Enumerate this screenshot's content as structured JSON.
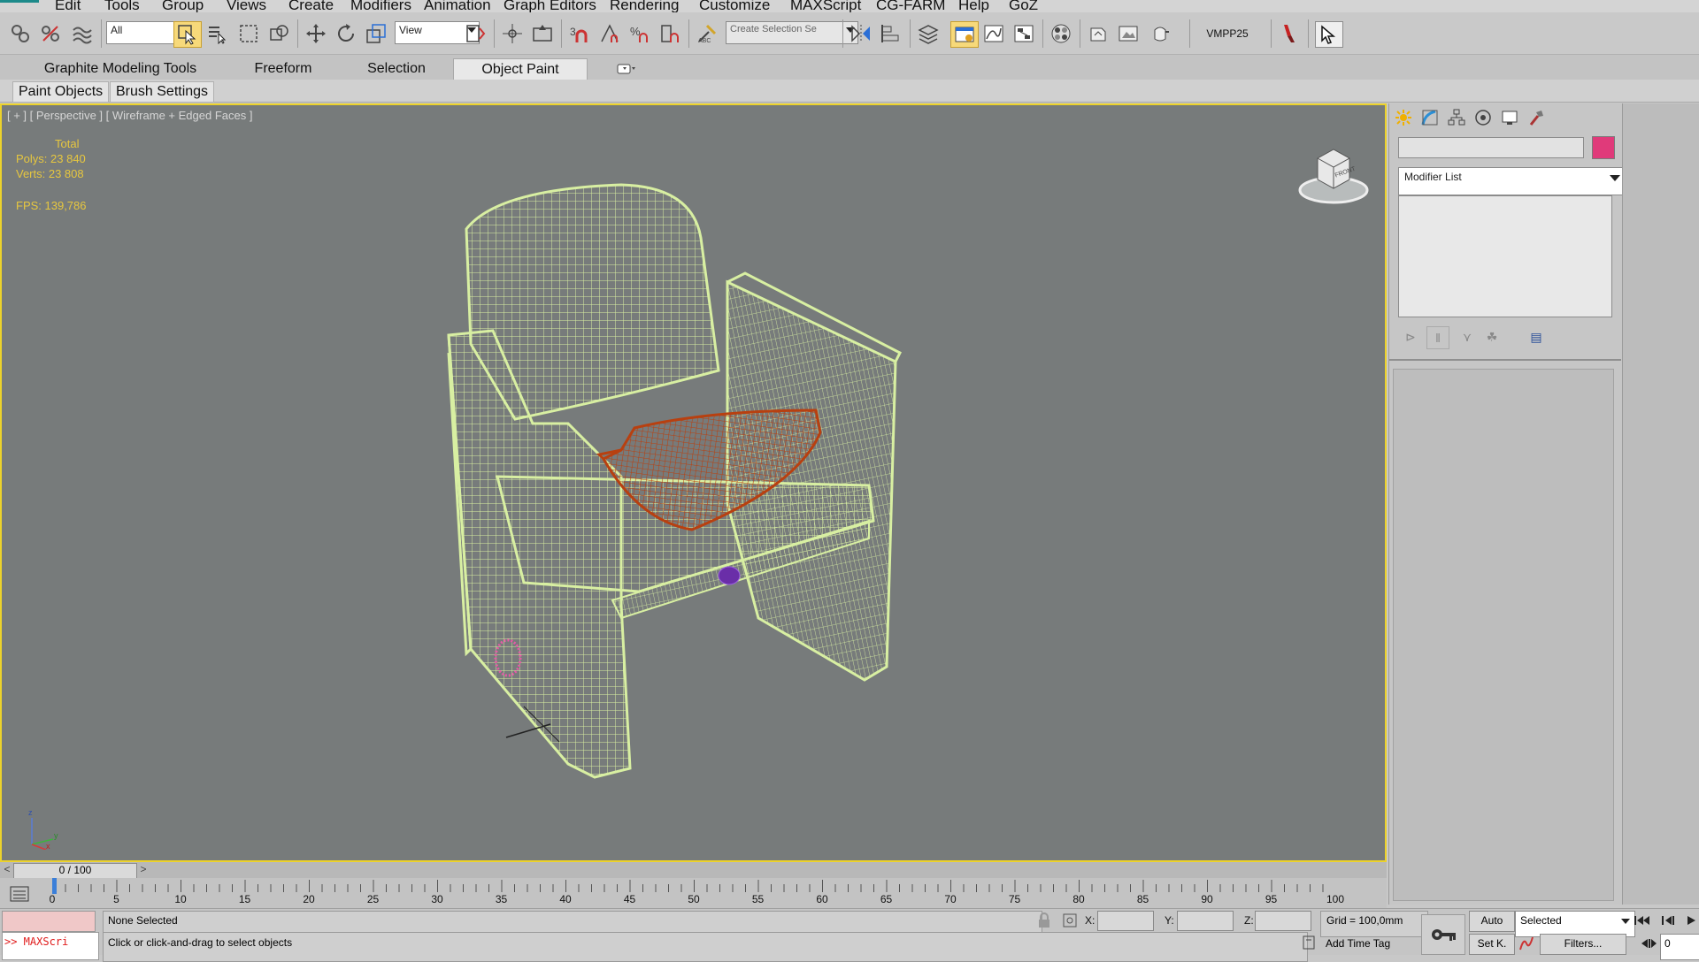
{
  "menubar": {
    "items": [
      "Edit",
      "Tools",
      "Group",
      "Views",
      "Create",
      "Modifiers",
      "Animation",
      "Graph Editors",
      "Rendering",
      "Customize",
      "MAXScript",
      "CG-FARM",
      "Help",
      "GoZ"
    ]
  },
  "toolbar": {
    "selection_filter": "All",
    "reference_coord": "View",
    "named_selection_placeholder": "Create Selection Se",
    "vmpp_label": "VMPP25"
  },
  "ribbon": {
    "tabs": [
      "Graphite Modeling Tools",
      "Freeform",
      "Selection",
      "Object Paint"
    ],
    "active_tab": "Object Paint",
    "panels": [
      "Paint Objects",
      "Brush Settings"
    ]
  },
  "viewport": {
    "label": "[ + ] [ Perspective ] [ Wireframe + Edged Faces ]",
    "stats": {
      "total_label": "Total",
      "polys": "Polys: 23 840",
      "verts": "Verts: 23 808",
      "fps": "FPS:   139,786"
    },
    "viewcube_face": "FRONT",
    "colors": {
      "frame_wire": "#d8efa2",
      "seat_wire": "#b84010",
      "active_border": "#ecd22b",
      "stats_text": "#e7c73f"
    }
  },
  "command_panel": {
    "modifier_list": "Modifier List",
    "object_color": "#e03a7a"
  },
  "timeline": {
    "slider_label": "0 / 100",
    "prev": "<",
    "next": ">",
    "ticks": [
      "0",
      "5",
      "10",
      "15",
      "20",
      "25",
      "30",
      "35",
      "40",
      "45",
      "50",
      "55",
      "60",
      "65",
      "70",
      "75",
      "80",
      "85",
      "90",
      "95",
      "100"
    ]
  },
  "statusbar": {
    "maxscript": ">> MAXScri",
    "selection": "None Selected",
    "prompt": "Click or click-and-drag to select objects",
    "x_label": "X:",
    "y_label": "Y:",
    "z_label": "Z:",
    "grid": "Grid = 100,0mm",
    "add_time_tag": "Add Time Tag",
    "auto_key": "Auto",
    "set_key": "Set K.",
    "key_mode": "Selected",
    "filters": "Filters...",
    "current_frame": "0"
  }
}
